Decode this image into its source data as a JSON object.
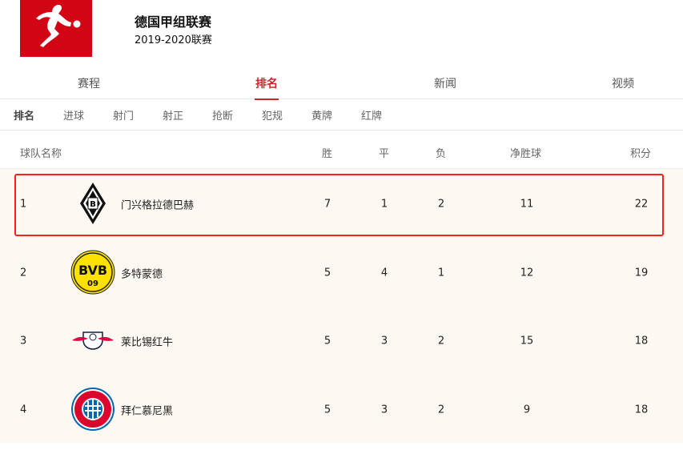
{
  "league": {
    "title": "德国甲组联赛",
    "season": "2019-2020联赛"
  },
  "tabs": [
    "赛程",
    "排名",
    "新闻",
    "视频"
  ],
  "subtabs": [
    "排名",
    "进球",
    "射门",
    "射正",
    "抢断",
    "犯规",
    "黄牌",
    "红牌"
  ],
  "headers": {
    "team": "球队名称",
    "w": "胜",
    "d": "平",
    "l": "负",
    "gd": "净胜球",
    "pts": "积分"
  },
  "rows": [
    {
      "rank": "1",
      "team": "门兴格拉德巴赫",
      "w": "7",
      "d": "1",
      "l": "2",
      "gd": "11",
      "pts": "22"
    },
    {
      "rank": "2",
      "team": "多特蒙德",
      "w": "5",
      "d": "4",
      "l": "1",
      "gd": "12",
      "pts": "19"
    },
    {
      "rank": "3",
      "team": "莱比锡红牛",
      "w": "5",
      "d": "3",
      "l": "2",
      "gd": "15",
      "pts": "18"
    },
    {
      "rank": "4",
      "team": "拜仁慕尼黑",
      "w": "5",
      "d": "3",
      "l": "2",
      "gd": "9",
      "pts": "18"
    }
  ]
}
